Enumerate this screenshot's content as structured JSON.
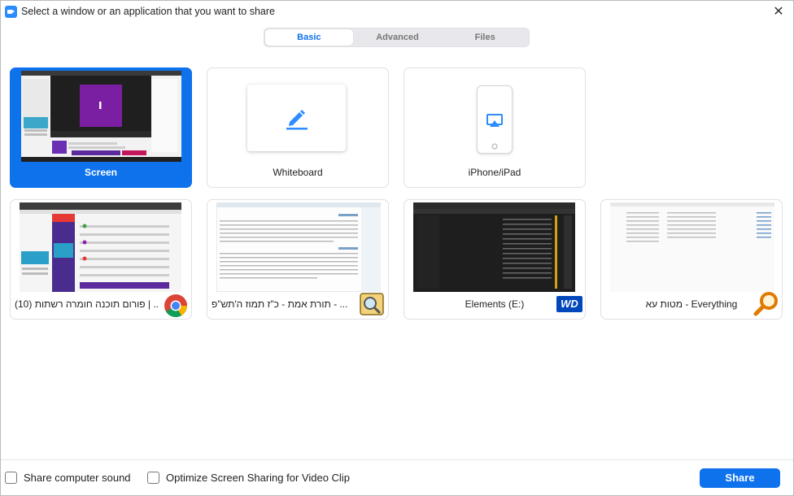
{
  "window": {
    "title": "Select a window or an application that you want to share",
    "close_glyph": "✕"
  },
  "tabs": [
    {
      "label": "Basic",
      "active": true
    },
    {
      "label": "Advanced",
      "active": false
    },
    {
      "label": "Files",
      "active": false
    }
  ],
  "cards": {
    "screen": {
      "label": "Screen",
      "selected": true
    },
    "whiteboard": {
      "label": "Whiteboard",
      "icon": "pen-icon"
    },
    "iphone": {
      "label": "iPhone/iPad",
      "icon": "airplay-icon"
    },
    "chrome": {
      "label": "(10) פורום תוכנה חומרה רשתות | ...",
      "badge": "chrome-icon"
    },
    "torah": {
      "label": "תורת אמת  -  כ\"ז תמוז ה'תש\"פ - ...",
      "badge": "magnifier-app-icon"
    },
    "elements": {
      "label": "Elements (E:)",
      "badge": "wd-drive-icon",
      "badge_text": "WD"
    },
    "everything": {
      "label": "מטות עא - Everything",
      "badge": "everything-search-icon"
    }
  },
  "footer": {
    "share_sound_label": "Share computer sound",
    "optimize_label": "Optimize Screen Sharing for Video Clip",
    "share_button": "Share"
  },
  "colors": {
    "accent": "#0e72ed",
    "tab_inactive": "#777777"
  }
}
